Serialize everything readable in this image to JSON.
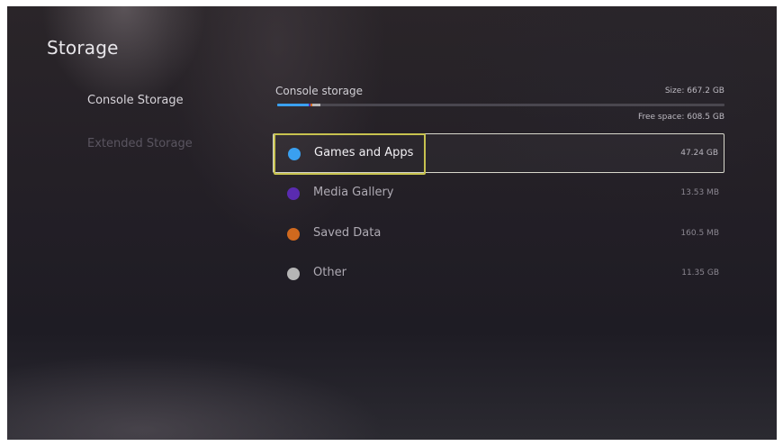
{
  "page": {
    "title": "Storage"
  },
  "sidebar": {
    "items": [
      {
        "label": "Console Storage",
        "state": "active"
      },
      {
        "label": "Extended Storage",
        "state": "disabled"
      }
    ]
  },
  "storage": {
    "label": "Console storage",
    "size_text": "Size: 667.2 GB",
    "free_text": "Free space: 608.5 GB",
    "bar": {
      "segments": [
        {
          "name": "Games and Apps",
          "color": "#3aa0f0",
          "value_gb": 47.24
        },
        {
          "name": "Media Gallery",
          "color": "#5a2bb0",
          "value_gb": 0.01353
        },
        {
          "name": "Saved Data",
          "color": "#d0691e",
          "value_gb": 0.1605
        },
        {
          "name": "Other",
          "color": "#b5b5b5",
          "value_gb": 11.35
        }
      ],
      "total_gb": 667.2,
      "track_color": "#4a474f"
    }
  },
  "categories": [
    {
      "label": "Games and Apps",
      "size": "47.24 GB",
      "color": "#3aa0f0",
      "selected": true,
      "icon": "blue-dot-icon"
    },
    {
      "label": "Media Gallery",
      "size": "13.53 MB",
      "color": "#5a2bb0",
      "selected": false,
      "icon": "purple-dot-icon"
    },
    {
      "label": "Saved Data",
      "size": "160.5 MB",
      "color": "#d0691e",
      "selected": false,
      "icon": "orange-dot-icon"
    },
    {
      "label": "Other",
      "size": "11.35 GB",
      "color": "#b5b5b5",
      "selected": false,
      "icon": "gray-dot-icon"
    }
  ],
  "colors": {
    "focus_highlight": "#c7c24f",
    "selected_row_border": "#d8d8cc"
  }
}
